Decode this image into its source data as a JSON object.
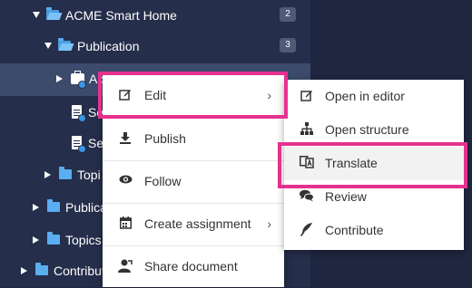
{
  "tree": {
    "rows": [
      {
        "label": "ACME Smart Home",
        "badge": "2"
      },
      {
        "label": "Publication",
        "badge": "3"
      },
      {
        "label": "Ac"
      },
      {
        "label": "Se"
      },
      {
        "label": "Se"
      },
      {
        "label": "Topi"
      },
      {
        "label": "Publica"
      },
      {
        "label": "Topics"
      },
      {
        "label": "Contribut"
      }
    ]
  },
  "context_menu": {
    "items": [
      {
        "label": "Edit",
        "icon": "edit-icon"
      },
      {
        "label": "Publish",
        "icon": "download-icon"
      },
      {
        "label": "Follow",
        "icon": "eye-icon"
      },
      {
        "label": "Create assignment",
        "icon": "calendar-icon"
      },
      {
        "label": "Share document",
        "icon": "share-user-icon"
      }
    ]
  },
  "submenu": {
    "items": [
      {
        "label": "Open in editor",
        "icon": "edit-icon"
      },
      {
        "label": "Open structure",
        "icon": "structure-icon"
      },
      {
        "label": "Translate",
        "icon": "translate-icon"
      },
      {
        "label": "Review",
        "icon": "comments-icon"
      },
      {
        "label": "Contribute",
        "icon": "feather-icon"
      }
    ]
  },
  "colors": {
    "highlight": "#e6318f",
    "tree_bg": "#252e4a",
    "folder": "#5aaef0"
  }
}
